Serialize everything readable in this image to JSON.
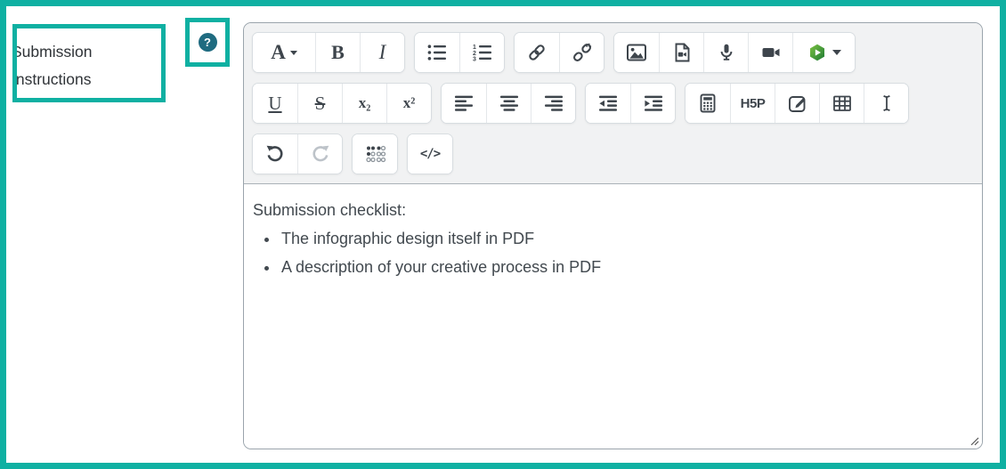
{
  "colors": {
    "accent_teal": "#0fb0a2",
    "help_circle_bg": "#1f6b80"
  },
  "field": {
    "label": "Submission Instructions",
    "help_glyph": "?"
  },
  "toolbar": {
    "paragraph_letter": "A",
    "bold": "B",
    "italic": "I",
    "underline": "U",
    "strikethrough": "S",
    "subscript": "x₂",
    "superscript": "x²",
    "h5p": "H5P",
    "html_code": "</>",
    "ol_numbers": [
      "1",
      "2",
      "3"
    ]
  },
  "content": {
    "heading": "Submission checklist:",
    "bullets": [
      "The infographic design itself in PDF",
      "A description of your creative process in PDF"
    ]
  }
}
